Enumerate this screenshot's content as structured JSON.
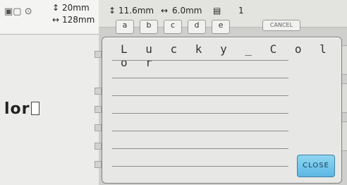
{
  "left": {
    "height_label": "20mm",
    "width_label": "128mm",
    "partial_text": "lor"
  },
  "top_bar": {
    "height_value": "11.6mm",
    "width_value": "6.0mm",
    "count_value": "1",
    "keys": [
      "a",
      "b",
      "c",
      "d",
      "e"
    ],
    "cancel_label": "CANCEL"
  },
  "dialog": {
    "lines": [
      "L u c k y _ C o l o r",
      "",
      "",
      "",
      "",
      "",
      ""
    ],
    "close_label": "CLOSE"
  }
}
